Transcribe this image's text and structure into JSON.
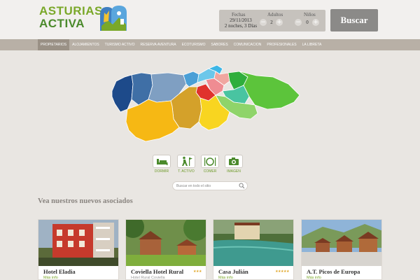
{
  "header": {
    "logo": {
      "line1": "ASTURIAS",
      "line2": "ACTIVA"
    },
    "booking": {
      "fechas_label": "Fechas",
      "date": "29/11/2013",
      "nights": "2 noches, 3 Días",
      "adultos_label": "Adultos",
      "adultos_value": "2",
      "ninos_label": "Niños",
      "ninos_value": "0",
      "minus": "−",
      "plus": "+"
    },
    "search_button": "Buscar"
  },
  "nav": {
    "items": [
      "Propietarios",
      "Alojamientos",
      "Turismo activo",
      "Reserva aventura",
      "Ecoturismo",
      "Sabores",
      "Comunicacion",
      "Profesionales",
      "La libreta"
    ]
  },
  "map": {
    "region_colors": {
      "west": "#1d4a8a",
      "west2": "#3f6fa6",
      "center_west": "#7f9fc2",
      "center_blue": "#4a9fd6",
      "light_blue": "#6cc7ea",
      "sky": "#3db6e6",
      "red": "#e0322c",
      "pink": "#ef8c92",
      "salmon": "#f0a6a0",
      "ochre": "#d4a12a",
      "yellow": "#f6b814",
      "bright_yellow": "#f8d520",
      "green_dark": "#2fae3c",
      "green": "#5cc43b",
      "light_green": "#8fd46a",
      "teal": "#49c4a1"
    }
  },
  "categories": [
    {
      "label": "Dormir",
      "icon": "bed-icon"
    },
    {
      "label": "T. Activo",
      "icon": "hiker-icon"
    },
    {
      "label": "Comer",
      "icon": "plate-icon"
    },
    {
      "label": "Imagen",
      "icon": "camera-icon"
    }
  ],
  "site_search": {
    "placeholder": "Buscar en todo el sitio",
    "icon": "search-icon"
  },
  "section_title": "Vea nuestros nuevos asociados",
  "cards": [
    {
      "name": "Hotel Eladia",
      "stars": "",
      "sub": "Más info"
    },
    {
      "name": "Coviella Hotel Rural",
      "stars": "★★★",
      "sub": "Hotel Rural Coviella"
    },
    {
      "name": "Casa Julián",
      "stars": "★★★★★",
      "sub": "Más info"
    },
    {
      "name": "A.T. Picos de Europa",
      "stars": "",
      "sub": "Más info"
    }
  ],
  "colors": {
    "accent_green": "#7aa829",
    "button_grey": "#8b8a88",
    "nav": "#b8b0a6",
    "star": "#e0a526"
  }
}
